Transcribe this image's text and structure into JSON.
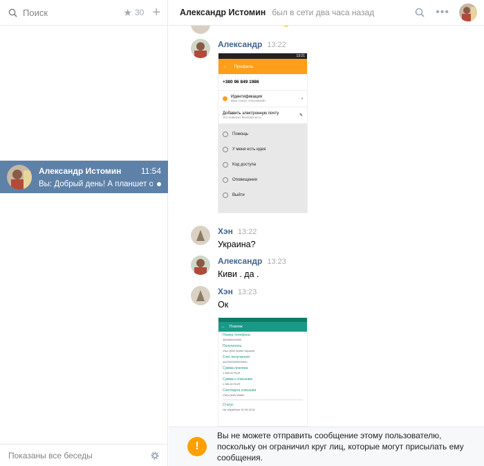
{
  "sidebar": {
    "search_placeholder": "Поиск",
    "favorites_count": "30",
    "footer_text": "Показаны все беседы"
  },
  "conversation": {
    "name": "Александр Истомин",
    "time": "11:54",
    "preview": "Вы: Добрый день! А планшет отпр..."
  },
  "chat": {
    "name": "Александр Истомин",
    "status": "был в сети два часа назад"
  },
  "messages": [
    {
      "author": "Александр",
      "time": "13:22",
      "text": ""
    },
    {
      "author": "Хэн",
      "time": "13:22",
      "text": "Украина?"
    },
    {
      "author": "Александр",
      "time": "13:23",
      "text": "Киви . да ."
    },
    {
      "author": "Хэн",
      "time": "13:23",
      "text": "Ок"
    }
  ],
  "screenshot1": {
    "status_time": "13:21",
    "title": "Профиль",
    "phone": "+380 96 849 1986",
    "ident": "Идентификация",
    "ident_sub": "Ваш статус «Основной»",
    "add_email": "Добавить электронную почту",
    "add_email_sub": "Это повысит безопасность",
    "menu": [
      "Помощь",
      "У меня есть идея",
      "Код доступа",
      "Оповещения",
      "Выйти"
    ]
  },
  "screenshot2": {
    "title": "Платеж",
    "fields": [
      {
        "label": "Номер телефона",
        "value": "380968491986"
      },
      {
        "label": "Получатель",
        "value": "Visa QIWI Wallet Украина"
      },
      {
        "label": "Счет получателя",
        "value": "4622000000000000"
      },
      {
        "label": "Сумма платежа",
        "value": "1 580,00 RUR"
      },
      {
        "label": "Сумма к списанию",
        "value": "1 580,00 RUR"
      },
      {
        "label": "Счет/карта списания",
        "value": "VISA QIWI Wallet"
      },
      {
        "label": "Статус",
        "value": "На обработке 01.06.2018"
      }
    ]
  },
  "notice": {
    "text": "Вы не можете отправить сообщение этому пользователю, поскольку он ограничил круг лиц, которые могут присылать ему сообщения."
  },
  "colors": {
    "accent": "#5e81a8",
    "author": "#42648b",
    "warning": "#ffa000"
  }
}
